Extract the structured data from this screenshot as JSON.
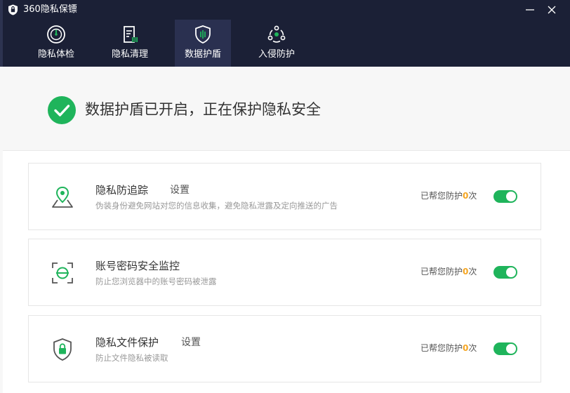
{
  "window": {
    "title": "360隐私保镖"
  },
  "nav": {
    "tabs": [
      {
        "label": "隐私体检",
        "icon": "gauge-icon"
      },
      {
        "label": "隐私清理",
        "icon": "document-clean-icon"
      },
      {
        "label": "数据护盾",
        "icon": "shield-icon",
        "active": true
      },
      {
        "label": "入侵防护",
        "icon": "network-defense-icon"
      }
    ]
  },
  "status": {
    "text": "数据护盾已开启，正在保护隐私安全",
    "icon": "check-circle-icon"
  },
  "features": [
    {
      "title": "隐私防追踪",
      "settings_label": "设置",
      "description": "伪装身份避免网站对您的信息收集，避免隐私泄露及定向推送的广告",
      "count_prefix": "已帮您防护",
      "count": "0",
      "count_suffix": "次",
      "enabled": true,
      "icon": "location-pin-icon"
    },
    {
      "title": "账号密码安全监控",
      "description": "防止您浏览器中的账号密码被泄露",
      "count_prefix": "已帮您防护",
      "count": "0",
      "count_suffix": "次",
      "enabled": true,
      "icon": "face-scan-icon"
    },
    {
      "title": "隐私文件保护",
      "settings_label": "设置",
      "description": "防止文件隐私被读取",
      "count_prefix": "已帮您防护",
      "count": "0",
      "count_suffix": "次",
      "enabled": true,
      "icon": "shield-lock-icon"
    }
  ],
  "colors": {
    "header_bg": "#1b2036",
    "active_tab_bg": "#2a3050",
    "accent_green": "#1fb45b",
    "count_orange": "#f5a623"
  }
}
